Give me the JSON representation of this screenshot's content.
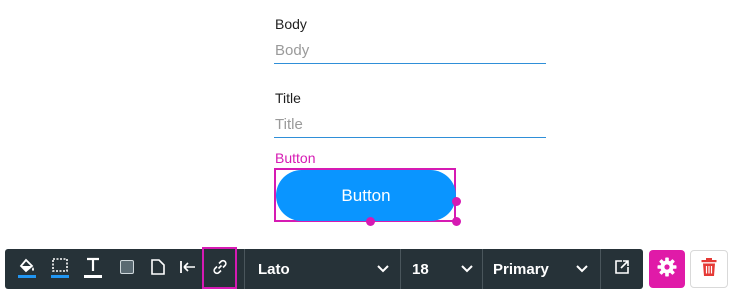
{
  "form": {
    "body": {
      "label": "Body",
      "placeholder": "Body"
    },
    "title": {
      "label": "Title",
      "placeholder": "Title"
    },
    "button": {
      "label": "Button",
      "text": "Button"
    }
  },
  "toolbar": {
    "tools": [
      {
        "icon": "fill-color-icon"
      },
      {
        "icon": "border-color-icon"
      },
      {
        "icon": "text-color-icon"
      },
      {
        "icon": "background-square-icon"
      },
      {
        "icon": "page-icon"
      },
      {
        "icon": "align-left-icon"
      },
      {
        "icon": "link-icon",
        "active": true
      }
    ],
    "font": "Lato",
    "size": "18",
    "style": "Primary",
    "open_icon": "external-link-icon",
    "settings_icon": "gear-icon",
    "delete_icon": "trash-icon"
  },
  "colors": {
    "accent": "#d61ab3",
    "button": "#0a95ff",
    "toolbar_bg": "#263238",
    "underline": "#2f8fd8",
    "delete": "#e53935"
  }
}
